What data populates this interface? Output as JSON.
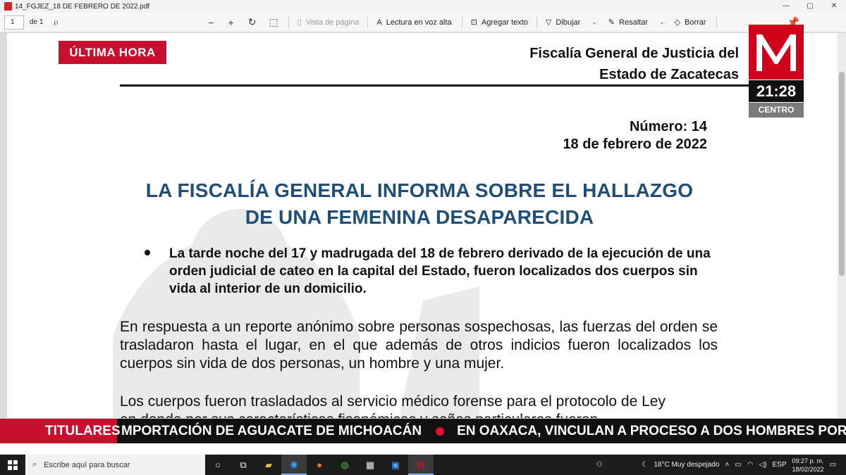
{
  "window": {
    "title": "14_FGJEZ_18 DE FEBRERO DE 2022.pdf"
  },
  "toolbar": {
    "page_number": "1",
    "page_total": "de 1",
    "page_view": "Vista de página",
    "read_aloud": "Lectura en voz alta",
    "add_text": "Agregar texto",
    "draw": "Dibujar",
    "highlight": "Resaltar",
    "erase": "Borrar"
  },
  "document": {
    "org_line1": "Fiscalía General de Justicia del",
    "org_line2": "Estado de Zacatecas",
    "number": "Número: 14",
    "date": "18 de febrero de 2022",
    "headline_line1": "LA FISCALÍA GENERAL INFORMA SOBRE EL HALLAZGO",
    "headline_line2": "DE UNA FEMENINA DESAPARECIDA",
    "bullet": "La tarde noche del 17 y madrugada del 18 de febrero derivado de la ejecución de una orden judicial de cateo en la capital del Estado, fueron localizados dos cuerpos sin vida al interior de un domicilio.",
    "paragraph1": "En respuesta a un reporte anónimo sobre personas sospechosas, las fuerzas del orden se trasladaron hasta el lugar, en el que además de otros indicios fueron localizados los cuerpos sin vida de dos personas, un hombre y una mujer.",
    "paragraph2_line1": "Los cuerpos fueron trasladados al servicio médico forense para el protocolo de Ley",
    "paragraph2_line2": "en donde por sus características fisonómicas y señas particulares fueron"
  },
  "broadcast": {
    "breaking": "ÚLTIMA HORA",
    "logo_letter": "M",
    "time": "21:28",
    "zone": "CENTRO",
    "ticker_label": "TITULARES",
    "ticker_item1": "MPORTACIÓN DE AGUACATE DE MICHOACÁN",
    "ticker_item2": "EN OAXACA, VINCULAN A PROCESO A DOS HOMBRES POR ASESIN",
    "accent": "#c8102e"
  },
  "taskbar": {
    "search_placeholder": "Escribe aquí para buscar",
    "weather": "18°C  Muy despejado",
    "language": "ESP",
    "time": "09:27 p. m.",
    "date": "18/02/2022"
  }
}
